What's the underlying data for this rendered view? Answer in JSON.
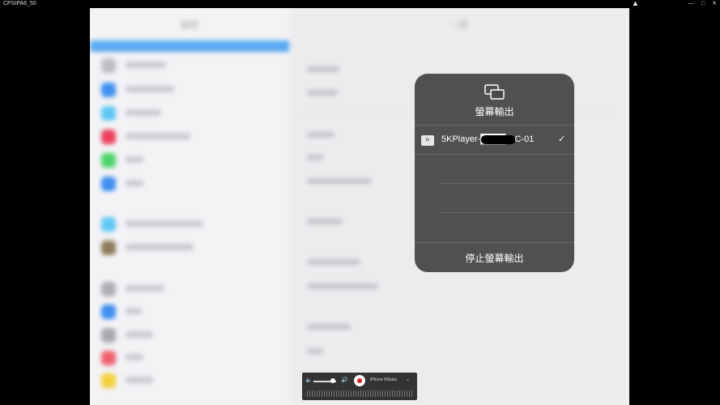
{
  "window": {
    "title": "CPSIPA6_50",
    "minimize_glyph": "—",
    "maximize_glyph": "□",
    "close_glyph": "✕"
  },
  "background": {
    "sidebar_header": "設定",
    "main_header": "一般"
  },
  "screen_mirroring": {
    "title": "螢幕輸出",
    "icon": "screen-mirroring-icon",
    "device": {
      "badge": "tv",
      "name": "5KPlayer-████-PC-01",
      "selected": true,
      "check": "✓"
    },
    "stop_label": "停止螢幕輸出"
  },
  "toolbar": {
    "volume_low_icon": "🔈",
    "volume_high_icon": "🔊",
    "volume_level": 0.85,
    "device_label": "iPhone 6/6plus",
    "chevron": "⌄"
  },
  "colors": {
    "popup_bg": "#4a4a4c",
    "record": "#e02020",
    "selection": "#5aa9f0"
  }
}
